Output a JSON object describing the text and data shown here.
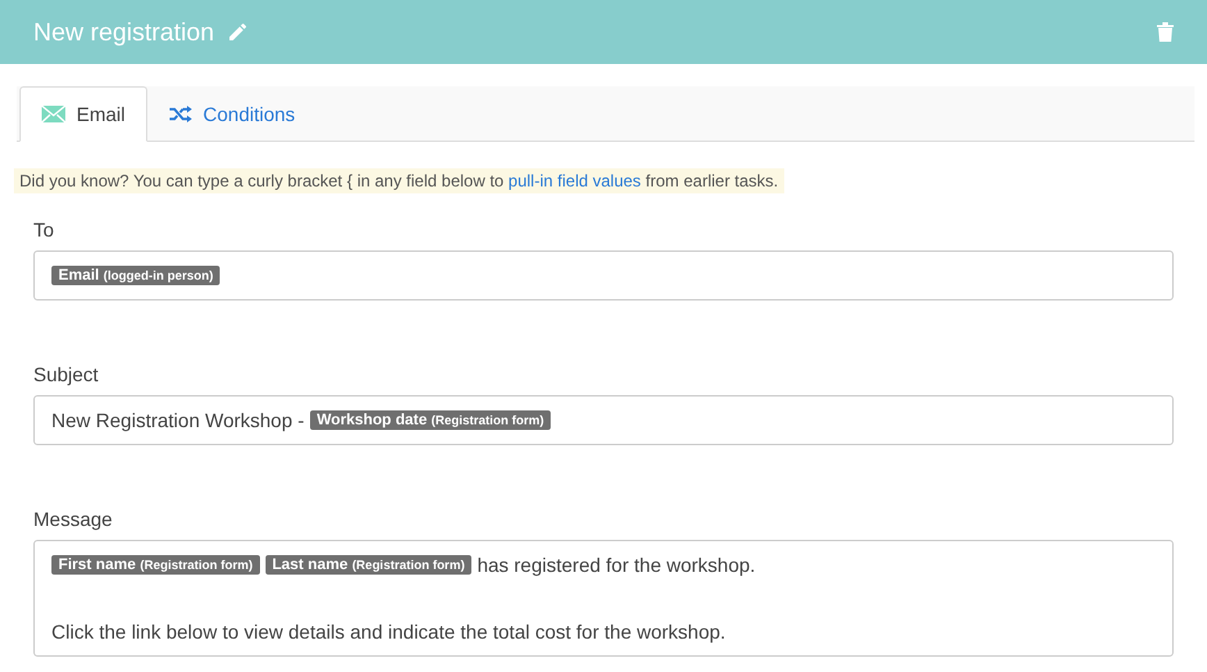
{
  "header": {
    "title": "New registration"
  },
  "tabs": [
    {
      "label": "Email",
      "selected": true,
      "kind": "mail"
    },
    {
      "label": "Conditions",
      "selected": false,
      "kind": "shuffle"
    }
  ],
  "tip": {
    "before": "Did you know? You can type a curly bracket { in any field below to",
    "link": "pull-in field values",
    "after": "from earlier tasks."
  },
  "fields": [
    {
      "label": "To",
      "lines": [
        [
          {
            "kind": "token",
            "name": "Email",
            "source": "(logged-in person)"
          }
        ]
      ]
    },
    {
      "label": "Subject",
      "lines": [
        [
          {
            "kind": "text",
            "text": "New Registration Workshop -"
          },
          {
            "kind": "token",
            "name": "Workshop date",
            "source": "(Registration form)"
          }
        ]
      ]
    },
    {
      "label": "Message",
      "lines": [
        [
          {
            "kind": "token",
            "name": "First name",
            "source": "(Registration form)"
          },
          {
            "kind": "token",
            "name": "Last name",
            "source": "(Registration form)"
          },
          {
            "kind": "text",
            "text": "has registered for the workshop."
          }
        ],
        [
          {
            "kind": "spacer"
          }
        ],
        [
          {
            "kind": "text",
            "text": "Click the link below to view details and indicate the total cost for the workshop."
          }
        ]
      ]
    }
  ]
}
